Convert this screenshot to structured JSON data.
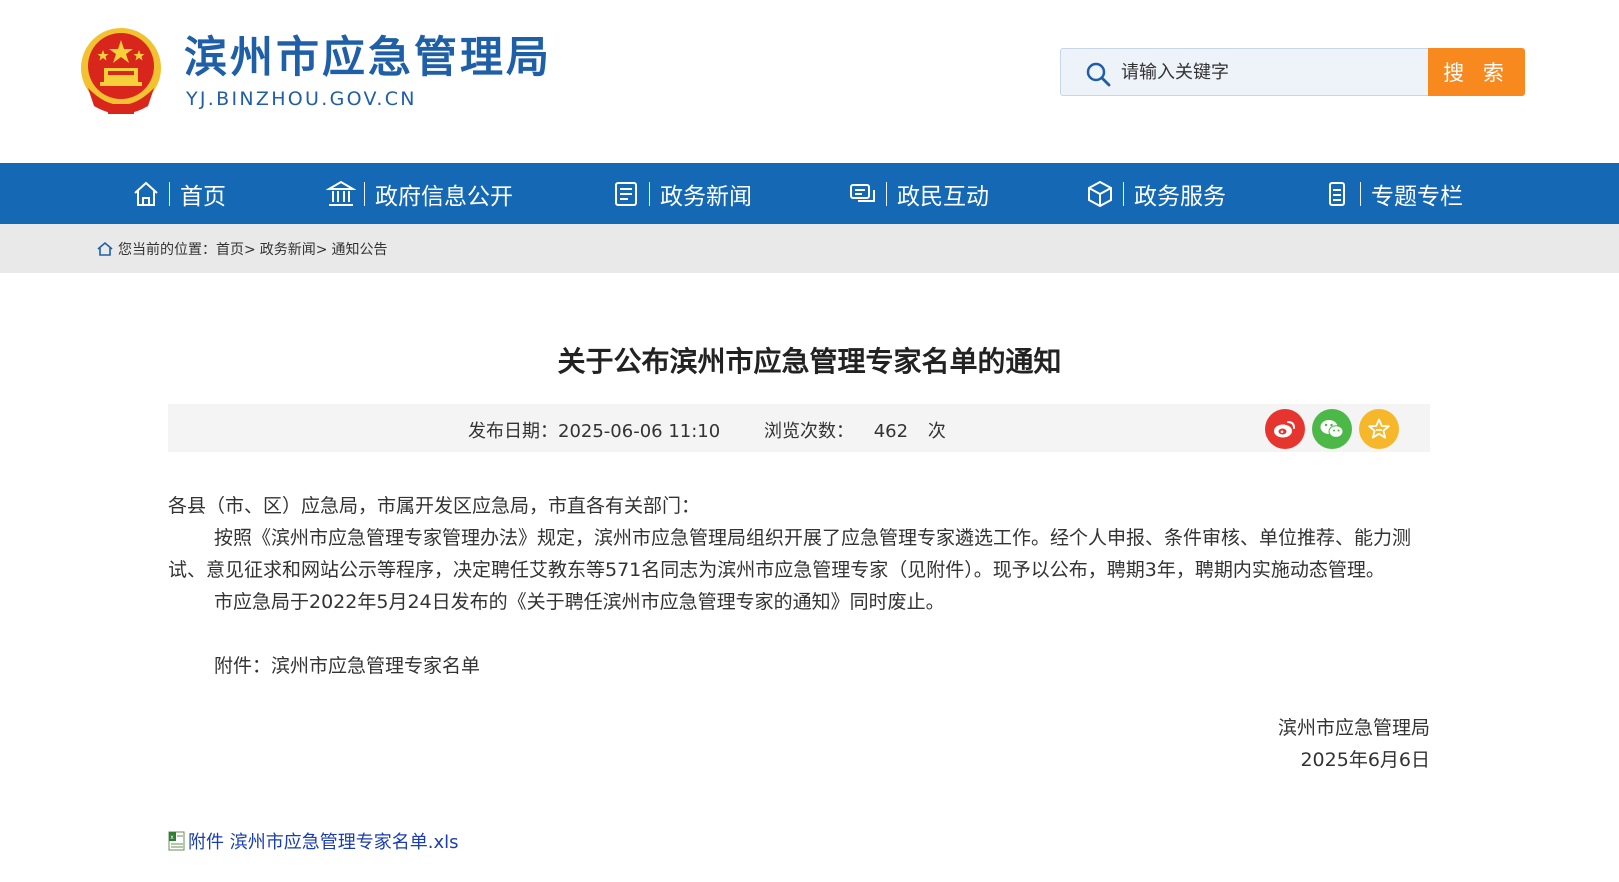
{
  "header": {
    "site_title": "滨州市应急管理局",
    "site_domain": "YJ.BINZHOU.GOV.CN",
    "search_placeholder": "请输入关键字",
    "search_button": "搜 索"
  },
  "nav": {
    "items": [
      {
        "label": "首页",
        "icon": "home-icon"
      },
      {
        "label": "政府信息公开",
        "icon": "government-building-icon"
      },
      {
        "label": "政务新闻",
        "icon": "news-icon"
      },
      {
        "label": "政民互动",
        "icon": "chat-icon"
      },
      {
        "label": "政务服务",
        "icon": "service-cube-icon"
      },
      {
        "label": "专题专栏",
        "icon": "column-icon"
      }
    ]
  },
  "breadcrumb": {
    "prefix": "您当前的位置：",
    "items": [
      "首页>",
      "政务新闻>",
      "通知公告"
    ]
  },
  "article": {
    "title": "关于公布滨州市应急管理专家名单的通知",
    "publish_label": "发布日期：2025-06-06 11:10",
    "views_label": "浏览次数：",
    "views_count": "462",
    "views_unit": "次",
    "share_icons": [
      "weibo-icon",
      "wechat-icon",
      "favorite-star-icon"
    ],
    "salutation": "各县（市、区）应急局，市属开发区应急局，市直各有关部门：",
    "paragraph1": "按照《滨州市应急管理专家管理办法》规定，滨州市应急管理局组织开展了应急管理专家遴选工作。经个人申报、条件审核、单位推荐、能力测试、意见征求和网站公示等程序，决定聘任艾教东等571名同志为滨州市应急管理专家（见附件）。现予以公布，聘期3年，聘期内实施动态管理。",
    "paragraph2": "市应急局于2022年5月24日发布的《关于聘任滨州市应急管理专家的通知》同时废止。",
    "attachment_note": "附件：滨州市应急管理专家名单",
    "signature_org": "滨州市应急管理局",
    "signature_date": "2025年6月6日",
    "attachment_link": "附件 滨州市应急管理专家名单.xls"
  },
  "colors": {
    "brand_blue": "#1569b4",
    "title_blue": "#1f5fa8",
    "search_orange": "#f7891f",
    "link_blue": "#1a3db3"
  }
}
